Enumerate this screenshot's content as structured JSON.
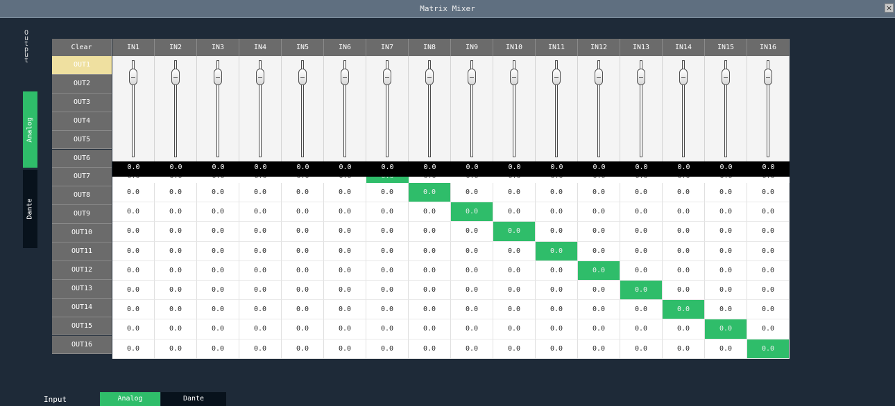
{
  "window": {
    "title": "Matrix Mixer",
    "close_label": "×"
  },
  "output_panel": {
    "label_chars": [
      "O",
      "u",
      "t",
      "p",
      "u",
      "t"
    ],
    "tabs": [
      {
        "label": "Analog",
        "selected": true
      },
      {
        "label": "Dante",
        "selected": false
      }
    ]
  },
  "matrix": {
    "clear_label": "Clear",
    "inputs": [
      "IN1",
      "IN2",
      "IN3",
      "IN4",
      "IN5",
      "IN6",
      "IN7",
      "IN8",
      "IN9",
      "IN10",
      "IN11",
      "IN12",
      "IN13",
      "IN14",
      "IN15",
      "IN16"
    ],
    "outputs": [
      "OUT1",
      "OUT2",
      "OUT3",
      "OUT4",
      "OUT5",
      "OUT6",
      "OUT7",
      "OUT8",
      "OUT9",
      "OUT10",
      "OUT11",
      "OUT12",
      "OUT13",
      "OUT14",
      "OUT15",
      "OUT16"
    ],
    "selected_output": "OUT1",
    "fader_values": [
      "0.0",
      "0.0",
      "0.0",
      "0.0",
      "0.0",
      "0.0",
      "0.0",
      "0.0",
      "0.0",
      "0.0",
      "0.0",
      "0.0",
      "0.0",
      "0.0",
      "0.0",
      "0.0"
    ],
    "cell_value": "0.0",
    "active_color": "#2fbd6a",
    "selected_row_color": "#efe0a0"
  },
  "input_panel": {
    "label": "Input",
    "tabs": [
      {
        "label": "Analog",
        "selected": true
      },
      {
        "label": "Dante",
        "selected": false
      }
    ]
  }
}
